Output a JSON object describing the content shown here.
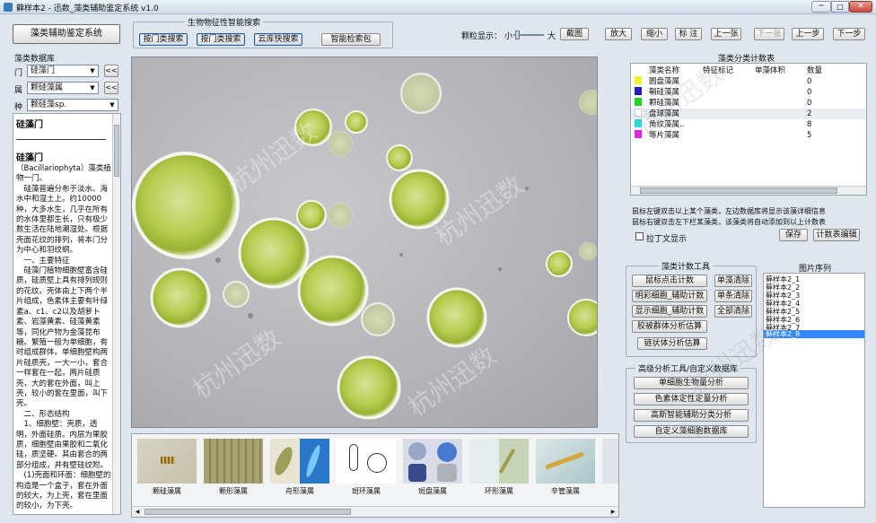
{
  "window": {
    "title": "藓样本2 - 迅数_藻类辅助鉴定系统 v1.0"
  },
  "app_button": "藻类辅助鉴定系统",
  "search_group": {
    "title": "生物物征性智能搜索",
    "buttons": [
      "按门类搜索",
      "按门类搜索",
      "云库快搜索"
    ],
    "smart": "智能检索包"
  },
  "toolbar": {
    "particle_label": "颗粒显示：",
    "small": "小",
    "large": "大",
    "buttons": [
      "截图",
      "放大",
      "缩小",
      "标 注",
      "上一张",
      "下一张",
      "上一步",
      "下一步"
    ]
  },
  "library": {
    "title": "藻类数据库",
    "rows": [
      {
        "label": "门",
        "value": "硅藻门",
        "nav": "<<"
      },
      {
        "label": "属",
        "value": "颗硅藻属",
        "nav": "<<"
      },
      {
        "label": "种",
        "value": "颗硅藻sp."
      }
    ]
  },
  "description": {
    "heading": "硅藻门",
    "sub": "硅藻门",
    "body": "（Bacillariophyta）藻类植物一门。\n　硅藻普遍分布于淡水、海水中和湿土上。约10000种，大多水生，几乎在所有的水体里都生长，只有极少数生活在陆地潮湿处。根据壳面花纹的排列，将本门分为中心和羽纹纲。\n　一、主要特征\n　硅藻门植物细胞壁富含硅质，硅质壁上具有排列规则的花纹。壳体由上下两个半片组成，色素体主要有叶绿素a、c1、c2以及胡萝卜素、岩藻黄素、硅藻黄素等，同化产物为金藻昆布糖。繁殖一般为单细胞，有时组成群体。单细胞壁构两片硅质壳，一大一小，套合一样套在一起，两片硅质壳，大的套在外面，叫上壳，较小的套在里面，叫下壳。\n　二、形态结构\n　1、细胞壁：壳质，透明，外面硅质。内层为果胶质，细胞壁由果胶和二氧化硅，质坚硬。其由套合的两部分组成，并有壁硅纹附。\n　(1)壳面和环面：细胞壁的构造是一个盒子，套在外面的较大，为上壳，套在里面的较小，为下壳。"
  },
  "stats": {
    "title": "藻类分类计数表",
    "headers": [
      "藻类名称",
      "特征标记",
      "单藻体积",
      "数量"
    ],
    "rows": [
      {
        "name": "圆盘藻属",
        "mark": "",
        "vol": "",
        "count": "0",
        "color": "#f2f22a"
      },
      {
        "name": "鞘硅藻属",
        "mark": "",
        "vol": "",
        "count": "0",
        "color": "#1e1ec8"
      },
      {
        "name": "颗硅藻属",
        "mark": "",
        "vol": "",
        "count": "0",
        "color": "#22d422"
      },
      {
        "name": "盘球藻属",
        "mark": "",
        "vol": "",
        "count": "2",
        "color": "#ffffff"
      },
      {
        "name": "角纹藻属..",
        "mark": "",
        "vol": "",
        "count": "8",
        "color": "#22e0e0"
      },
      {
        "name": "等片藻属",
        "mark": "",
        "vol": "",
        "count": "5",
        "color": "#e622e6"
      }
    ],
    "hint1": "鼠标左键双击以上某个藻类，左边数据库将显示该藻详细信息",
    "hint2": "鼠标右键双击左下栏某藻类，该藻类将自动添加到以上计数表",
    "checkbox": "拉丁文显示",
    "save": "保存",
    "report": "计数表编辑"
  },
  "count_tools": {
    "title": "藻类计数工具",
    "buttons": [
      "鼠标点击计数",
      "单藻清除",
      "明彩细胞_辅助计数",
      "单条清除",
      "显示细胞_辅助计数",
      "全部清除",
      "胶被群体分析估算",
      "链状体分析估算"
    ]
  },
  "advanced": {
    "title": "高级分析工具/自定义数据库",
    "buttons": [
      "单细胞生物量分析",
      "色素体定性定量分析",
      "高斯智能辅助分类分析",
      "自定义藻细胞数据库"
    ]
  },
  "image_list": {
    "title": "图片序列",
    "items": [
      "藓样本2_1",
      "藓样本2_2",
      "藓样本2_3",
      "藓样本2_4",
      "藓样本2_5",
      "藓样本2_6",
      "藓样本2_7",
      "藓样本2_8"
    ],
    "selected": 7
  },
  "thumbnails": [
    "颗硅藻属",
    "颗形藻属",
    "舟形藻属",
    "斑环藻属",
    "斑盘藻属",
    "环形藻属",
    "辛管藻属"
  ],
  "watermark": "杭州迅数"
}
